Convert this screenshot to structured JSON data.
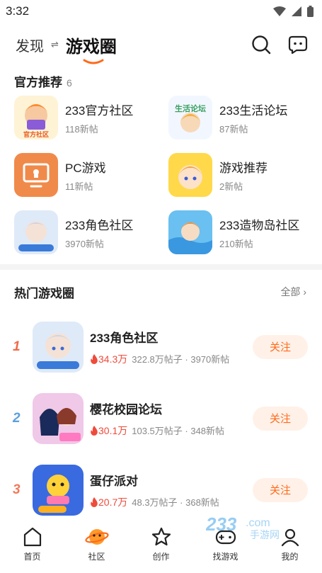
{
  "status": {
    "time": "3:32"
  },
  "nav": {
    "discover": "发现",
    "swap": "⇌",
    "current": "游戏圈"
  },
  "official": {
    "title": "官方推荐",
    "count": "6",
    "items": [
      {
        "name": "233官方社区",
        "sub": "118新帖"
      },
      {
        "name": "233生活论坛",
        "sub": "87新帖"
      },
      {
        "name": "PC游戏",
        "sub": "11新帖"
      },
      {
        "name": "游戏推荐",
        "sub": "2新帖"
      },
      {
        "name": "233角色社区",
        "sub": "3970新帖"
      },
      {
        "name": "233造物岛社区",
        "sub": "210新帖"
      }
    ]
  },
  "hot": {
    "title": "热门游戏圈",
    "all": "全部",
    "items": [
      {
        "rank": "1",
        "name": "233角色社区",
        "heat": "34.3万",
        "stats": "322.8万帖子 · 3970新帖",
        "follow": "关注"
      },
      {
        "rank": "2",
        "name": "樱花校园论坛",
        "heat": "30.1万",
        "stats": "103.5万帖子 · 348新帖",
        "follow": "关注"
      },
      {
        "rank": "3",
        "name": "蛋仔派对",
        "heat": "20.7万",
        "stats": "48.3万帖子 · 368新帖",
        "follow": "关注"
      }
    ]
  },
  "tabs": [
    "首页",
    "社区",
    "创作",
    "找游戏",
    "我的"
  ],
  "colors": {
    "accent": "#ff6a1a",
    "rank1": "#f06a4a",
    "rank2": "#5aa0dc",
    "rank3": "#f07a5a"
  }
}
